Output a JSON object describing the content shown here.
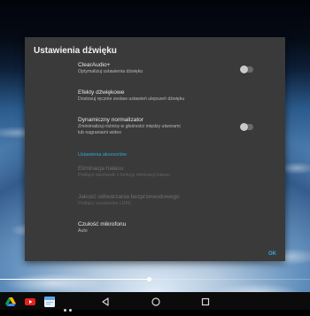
{
  "dialog": {
    "title": "Ustawienia dźwięku",
    "items": [
      {
        "title": "ClearAudio+",
        "subtitle": "Optymalizuj ustawienia dźwięku",
        "has_toggle": true,
        "toggle_state": "off"
      },
      {
        "title": "Efekty dźwiękowe",
        "subtitle": "Dostosuj ręcznie zestaw ustawień ulepszeń dźwięku",
        "has_toggle": false
      },
      {
        "title": "Dynamiczny normalizator",
        "subtitle_line1": "Zminimalizuj różnicę w głośności między utworami",
        "subtitle_line2": "lub nagraniami wideo",
        "has_toggle": true,
        "toggle_state": "off"
      }
    ],
    "section_header": "Ustawienia akcesoriów",
    "accessory_items": [
      {
        "title": "Eliminacja hałasu",
        "subtitle": "Podłącz słuchawki z funkcją eliminacji hałasu",
        "disabled": true
      },
      {
        "title": "Jakość odtwarzania bezprzewodowego",
        "subtitle": "Podłącz urządzenie LDAC",
        "disabled": true
      },
      {
        "title": "Czułość mikrofonu",
        "subtitle": "Auto",
        "disabled": false
      }
    ],
    "ok_label": "OK"
  },
  "playback": {
    "progress": 0.48
  },
  "navbar": {
    "apps": [
      "drive-icon",
      "youtube-icon",
      "gallery-icon"
    ],
    "buttons": [
      "back-icon",
      "home-icon",
      "recents-icon"
    ]
  },
  "colors": {
    "dialog_bg": "#3a3a3a",
    "accent": "#2fa8d8",
    "navbar_bg": "#0b0b0b"
  }
}
